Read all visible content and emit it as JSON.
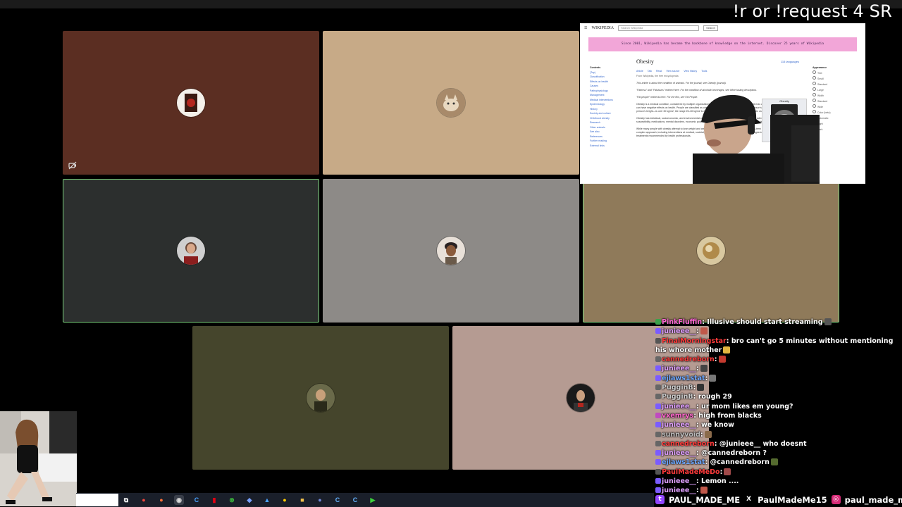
{
  "overlay": {
    "command_text": "!r or !request 4 SR"
  },
  "call": {
    "tiles": [
      {
        "id": "tile-1",
        "bg": "#5b2e22",
        "avatar": "red-album-avatar",
        "muted": true,
        "speaking": false
      },
      {
        "id": "tile-2",
        "bg": "#c7aa87",
        "avatar": "cat-avatar",
        "muted": false,
        "speaking": false
      },
      {
        "id": "tile-3",
        "bg": "#2c2f2e",
        "avatar": "person-avatar",
        "muted": false,
        "speaking": true
      },
      {
        "id": "tile-4",
        "bg": "#8d8a87",
        "avatar": "person-avatar",
        "muted": false,
        "speaking": false
      },
      {
        "id": "tile-5",
        "bg": "#8f7a5a",
        "avatar": "gold-avatar",
        "muted": false,
        "speaking": true
      },
      {
        "id": "tile-6",
        "bg": "#45452c",
        "avatar": "person-avatar",
        "muted": false,
        "speaking": false
      },
      {
        "id": "tile-7",
        "bg": "#b59b92",
        "avatar": "portrait-avatar",
        "muted": false,
        "speaking": false
      }
    ]
  },
  "browser": {
    "logo": "WIKIPEDIA",
    "search_placeholder": "Search Wikipedia",
    "search_button": "Search",
    "banner_text": "Since 2001, Wikipedia has become the backbone of knowledge on the internet. Discover 25 years of Wikipedia",
    "article_title": "Obesity",
    "languages": "115 languages",
    "tabs": [
      "Article",
      "Talk",
      "Read",
      "View source",
      "View history",
      "Tools"
    ],
    "from_line": "From Wikipedia, the free encyclopedia",
    "infobox_title": "Obesity",
    "appearance_label": "Appearance",
    "sidebar_items": [
      "Contents",
      "(Top)",
      "Classification",
      "Effects on health",
      "Causes",
      "Pathophysiology",
      "Management",
      "Medical interventions",
      "Epidemiology",
      "History",
      "Society and culture",
      "Childhood obesity",
      "Research",
      "Other animals",
      "See also",
      "References",
      "Further reading",
      "External links"
    ],
    "paragraphs": [
      "This article is about the condition of animals. For the journal, see Obesity (journal).",
      "\"Fatness\" and \"Fatsisses\" redirect here. For the condition of alcoholic beverages, see Wine tasting descriptors.",
      "\"Fat people\" redirects here. For the film, see Fat People.",
      "Obesity is a medical condition, considered by multiple organizations to be a disease, in which excess body fat has accumulated to such an extent that it can have negative effects on health. People are classified as obese when their body mass index (BMI)—a person's weight divided by the square of the person's height—is over 30 kg/m2; the range 25–30 kg/m2 is defined as overweight. Some East Asian countries use lower values to calculate obesity.",
      "Obesity has individual, socioeconomic, and environmental causes. Some known causes are diet, low physical activity, automation, urbanization, genetic susceptibility, medications, mental disorders, economic policies, endocrine disorders, and exposure to endocrine-disrupting chemicals.",
      "While many people with obesity attempt to lose weight and are often successful, maintaining weight loss long-term is rare. Obesity prevention requires a complex approach, including interventions at medical, societal, community, family, and individual levels. Changes to diet as well as exercising are the main treatments recommended by health professionals."
    ],
    "right_items": [
      "Text",
      "Small",
      "Standard",
      "Large",
      "Width",
      "Standard",
      "Wide",
      "Color (beta)",
      "Automatic",
      "Light",
      "Dark"
    ]
  },
  "chat": [
    {
      "user": "PinkFluffin",
      "color": "#ff69d6",
      "msg": ": Illusive should start streaming",
      "badge": "#3aa14a",
      "emote": "#555"
    },
    {
      "user": "junieee__",
      "color": "#e0a0ff",
      "msg": ":",
      "badge": "#7b5cff",
      "emote": "#c0584a"
    },
    {
      "user": "FinalMorningstar",
      "color": "#ff3b3b",
      "msg": ": bro can't go 5 minutes without mentioning his whore mother",
      "badge": "#555",
      "emote": "#e2b640",
      "wrap": true
    },
    {
      "user": "cannedreborn",
      "color": "#ff3b3b",
      "msg": ":",
      "badge": "#666",
      "emote": "#c43a2f"
    },
    {
      "user": "junieee__",
      "color": "#e0a0ff",
      "msg": ":",
      "badge": "#7b5cff",
      "emote": "#444"
    },
    {
      "user": "ejlaws1stat",
      "color": "#6fa8ff",
      "msg": ":",
      "badge": "#7b5cff",
      "emote": "#777"
    },
    {
      "user": "PugginB",
      "color": "#cccccc",
      "msg": ":",
      "badge": "#666",
      "emote": "#333"
    },
    {
      "user": "PugginB",
      "color": "#cccccc",
      "msg": ": rough 29",
      "badge": "#666",
      "emote": ""
    },
    {
      "user": "junieee__",
      "color": "#e0a0ff",
      "msg": ": ur mom likes em young?",
      "badge": "#7b5cff",
      "emote": ""
    },
    {
      "user": "vxemrys",
      "color": "#ff66cc",
      "msg": ": high from blacks",
      "badge": "#c04ac0",
      "emote": ""
    },
    {
      "user": "junieee__",
      "color": "#e0a0ff",
      "msg": ": we know",
      "badge": "#7b5cff",
      "emote": ""
    },
    {
      "user": "sunnyvoid",
      "color": "#bbbbbb",
      "msg": ":",
      "badge": "#666",
      "emote": "#8a6a4a"
    },
    {
      "user": "cannedreborn",
      "color": "#ff3b3b",
      "msg": ": @junieee__ who doesnt",
      "badge": "#666",
      "emote": ""
    },
    {
      "user": "junieee__",
      "color": "#e0a0ff",
      "msg": ": @cannedreborn ?",
      "badge": "#7b5cff",
      "emote": ""
    },
    {
      "user": "ejlaws1stat",
      "color": "#6fa8ff",
      "msg": ": @cannedreborn",
      "badge": "#7b5cff",
      "emote": "#556b2f"
    },
    {
      "user": "PaulMadeMeDo",
      "color": "#ff3b3b",
      "msg": ":",
      "badge": "#555",
      "emote": "#a04a4a"
    },
    {
      "user": "junieee__",
      "color": "#e0a0ff",
      "msg": ": Lemon ....",
      "badge": "#7b5cff",
      "emote": ""
    },
    {
      "user": "junieee__",
      "color": "#e0a0ff",
      "msg": ":",
      "badge": "#7b5cff",
      "emote": "#c0584a"
    }
  ],
  "socials": [
    {
      "icon": "twitch-icon",
      "glyph": "t",
      "color": "#9146ff",
      "handle": "PAUL_MADE_ME"
    },
    {
      "icon": "x-icon",
      "glyph": "X",
      "color": "#000000",
      "handle": "PaulMadeMe15"
    },
    {
      "icon": "instagram-icon",
      "glyph": "◎",
      "color": "#d62976",
      "handle": "paul_made_me"
    }
  ],
  "taskbar": {
    "icons": [
      {
        "name": "task-view-icon",
        "glyph": "⧉",
        "color": "#ffffff",
        "bg": "transparent"
      },
      {
        "name": "chrome-icon",
        "glyph": "●",
        "color": "#e8453c",
        "bg": "transparent"
      },
      {
        "name": "firefox-icon",
        "glyph": "●",
        "color": "#ff7139",
        "bg": "transparent"
      },
      {
        "name": "obs-icon",
        "glyph": "◉",
        "color": "#dddddd",
        "bg": "#3a3f4a"
      },
      {
        "name": "app-c-icon",
        "glyph": "C",
        "color": "#4aa3ff",
        "bg": "transparent"
      },
      {
        "name": "nintendo-icon",
        "glyph": "▮",
        "color": "#e60012",
        "bg": "transparent"
      },
      {
        "name": "xbox-icon",
        "glyph": "⊗",
        "color": "#3dbb3d",
        "bg": "transparent"
      },
      {
        "name": "app-diamond-icon",
        "glyph": "◆",
        "color": "#7aa2ff",
        "bg": "transparent"
      },
      {
        "name": "app-wing-icon",
        "glyph": "▲",
        "color": "#4aa3ff",
        "bg": "transparent"
      },
      {
        "name": "app-flame-icon",
        "glyph": "●",
        "color": "#ffcc00",
        "bg": "transparent"
      },
      {
        "name": "folder-icon",
        "glyph": "■",
        "color": "#f2c24c",
        "bg": "transparent"
      },
      {
        "name": "discord-icon",
        "glyph": "●",
        "color": "#7289da",
        "bg": "transparent"
      },
      {
        "name": "app-c2-icon",
        "glyph": "C",
        "color": "#66b3ff",
        "bg": "transparent"
      },
      {
        "name": "app-c3-icon",
        "glyph": "C",
        "color": "#66b3ff",
        "bg": "transparent"
      },
      {
        "name": "play-icon",
        "glyph": "▶",
        "color": "#3dd13d",
        "bg": "transparent"
      }
    ]
  }
}
